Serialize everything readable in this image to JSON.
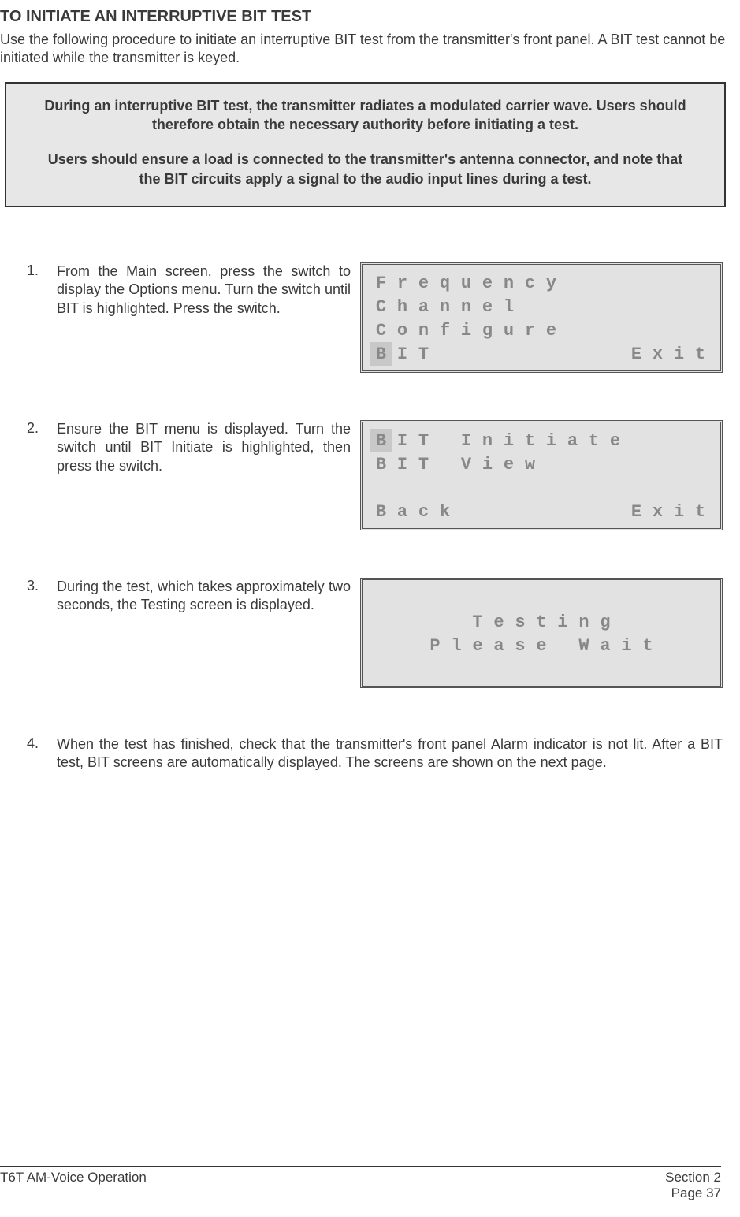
{
  "heading": "TO INITIATE AN INTERRUPTIVE BIT TEST",
  "intro": "Use the following procedure to initiate an interruptive BIT test from the transmitter's front panel.  A BIT test cannot be initiated while the transmitter is keyed.",
  "warning": {
    "p1": "During an interruptive BIT test, the transmitter radiates a modulated carrier wave. Users should therefore obtain the necessary authority before initiating a test.",
    "p2": "Users should ensure a load is connected to the transmitter's antenna connector, and note that the BIT circuits apply a signal to the audio input lines during a test."
  },
  "steps": [
    {
      "num": "1.",
      "text": "From the Main screen, press the switch to display the Options menu. Turn the switch until BIT is highlighted. Press the switch.",
      "lcd": {
        "rows": [
          {
            "cells": [
              {
                "t": "F"
              },
              {
                "t": "r"
              },
              {
                "t": "e"
              },
              {
                "t": "q"
              },
              {
                "t": "u"
              },
              {
                "t": "e"
              },
              {
                "t": "n"
              },
              {
                "t": "c"
              },
              {
                "t": "y"
              },
              {
                "t": ""
              },
              {
                "t": ""
              },
              {
                "t": ""
              },
              {
                "t": ""
              },
              {
                "t": ""
              },
              {
                "t": ""
              },
              {
                "t": ""
              }
            ]
          },
          {
            "cells": [
              {
                "t": "C"
              },
              {
                "t": "h"
              },
              {
                "t": "a"
              },
              {
                "t": "n"
              },
              {
                "t": "n"
              },
              {
                "t": "e"
              },
              {
                "t": "l"
              },
              {
                "t": ""
              },
              {
                "t": ""
              },
              {
                "t": ""
              },
              {
                "t": ""
              },
              {
                "t": ""
              },
              {
                "t": ""
              },
              {
                "t": ""
              },
              {
                "t": ""
              },
              {
                "t": ""
              }
            ]
          },
          {
            "cells": [
              {
                "t": "C"
              },
              {
                "t": "o"
              },
              {
                "t": "n"
              },
              {
                "t": "f"
              },
              {
                "t": "i"
              },
              {
                "t": "g"
              },
              {
                "t": "u"
              },
              {
                "t": "r"
              },
              {
                "t": "e"
              },
              {
                "t": ""
              },
              {
                "t": ""
              },
              {
                "t": ""
              },
              {
                "t": ""
              },
              {
                "t": ""
              },
              {
                "t": ""
              },
              {
                "t": ""
              }
            ]
          },
          {
            "cells": [
              {
                "t": "B",
                "hl": true
              },
              {
                "t": "I"
              },
              {
                "t": "T"
              },
              {
                "t": ""
              },
              {
                "t": ""
              },
              {
                "t": ""
              },
              {
                "t": ""
              },
              {
                "t": ""
              },
              {
                "t": ""
              },
              {
                "t": ""
              },
              {
                "t": ""
              },
              {
                "t": ""
              },
              {
                "t": "E"
              },
              {
                "t": "x"
              },
              {
                "t": "i"
              },
              {
                "t": "t"
              }
            ]
          }
        ]
      }
    },
    {
      "num": "2.",
      "text": "Ensure the BIT menu is displayed. Turn the switch until BIT Initiate is highlighted, then press the switch.",
      "lcd": {
        "rows": [
          {
            "cells": [
              {
                "t": "B",
                "hl": true
              },
              {
                "t": "I"
              },
              {
                "t": "T"
              },
              {
                "t": ""
              },
              {
                "t": "I"
              },
              {
                "t": "n"
              },
              {
                "t": "i"
              },
              {
                "t": "t"
              },
              {
                "t": "i"
              },
              {
                "t": "a"
              },
              {
                "t": "t"
              },
              {
                "t": "e"
              },
              {
                "t": ""
              },
              {
                "t": ""
              },
              {
                "t": ""
              },
              {
                "t": ""
              }
            ]
          },
          {
            "cells": [
              {
                "t": "B"
              },
              {
                "t": "I"
              },
              {
                "t": "T"
              },
              {
                "t": ""
              },
              {
                "t": "V"
              },
              {
                "t": "i"
              },
              {
                "t": "e"
              },
              {
                "t": "w"
              },
              {
                "t": ""
              },
              {
                "t": ""
              },
              {
                "t": ""
              },
              {
                "t": ""
              },
              {
                "t": ""
              },
              {
                "t": ""
              },
              {
                "t": ""
              },
              {
                "t": ""
              }
            ]
          },
          {
            "cells": [
              {
                "t": ""
              },
              {
                "t": ""
              },
              {
                "t": ""
              },
              {
                "t": ""
              },
              {
                "t": ""
              },
              {
                "t": ""
              },
              {
                "t": ""
              },
              {
                "t": ""
              },
              {
                "t": ""
              },
              {
                "t": ""
              },
              {
                "t": ""
              },
              {
                "t": ""
              },
              {
                "t": ""
              },
              {
                "t": ""
              },
              {
                "t": ""
              },
              {
                "t": ""
              }
            ]
          },
          {
            "cells": [
              {
                "t": "B"
              },
              {
                "t": "a"
              },
              {
                "t": "c"
              },
              {
                "t": "k"
              },
              {
                "t": ""
              },
              {
                "t": ""
              },
              {
                "t": ""
              },
              {
                "t": ""
              },
              {
                "t": ""
              },
              {
                "t": ""
              },
              {
                "t": ""
              },
              {
                "t": ""
              },
              {
                "t": "E"
              },
              {
                "t": "x"
              },
              {
                "t": "i"
              },
              {
                "t": "t"
              }
            ]
          }
        ]
      }
    },
    {
      "num": "3.",
      "text": "During the test, which takes approximately two seconds, the Testing screen is displayed.",
      "lcd": {
        "centered": true,
        "rows": [
          {
            "cells": [
              {
                "t": ""
              }
            ]
          },
          {
            "cells": [
              {
                "t": "T"
              },
              {
                "t": "e"
              },
              {
                "t": "s"
              },
              {
                "t": "t"
              },
              {
                "t": "i"
              },
              {
                "t": "n"
              },
              {
                "t": "g"
              }
            ]
          },
          {
            "cells": [
              {
                "t": "P"
              },
              {
                "t": "l"
              },
              {
                "t": "e"
              },
              {
                "t": "a"
              },
              {
                "t": "s"
              },
              {
                "t": "e"
              },
              {
                "t": ""
              },
              {
                "t": "W"
              },
              {
                "t": "a"
              },
              {
                "t": "i"
              },
              {
                "t": "t"
              }
            ]
          },
          {
            "cells": [
              {
                "t": ""
              }
            ]
          }
        ]
      }
    },
    {
      "num": "4.",
      "text": "When the test has finished, check that the transmitter's front panel Alarm indicator is not lit. After a BIT test, BIT screens are automatically displayed. The screens are shown on the next page."
    }
  ],
  "footer": {
    "left": "T6T AM-Voice Operation",
    "right1": "Section 2",
    "right2": "Page 37"
  }
}
